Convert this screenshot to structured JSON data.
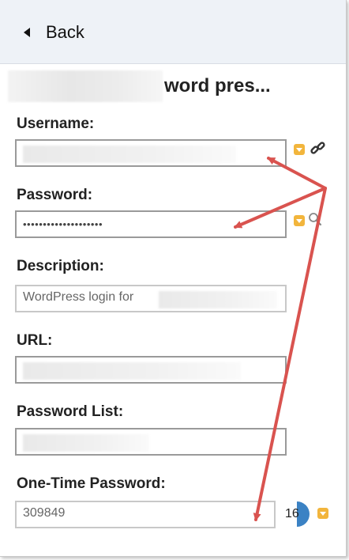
{
  "header": {
    "back_label": "Back"
  },
  "entry": {
    "title_visible": "word pres..."
  },
  "fields": {
    "username": {
      "label": "Username:"
    },
    "password": {
      "label": "Password:",
      "value": "••••••••••••••••••••"
    },
    "description": {
      "label": "Description:",
      "value": "WordPress login for"
    },
    "url": {
      "label": "URL:"
    },
    "password_list": {
      "label": "Password List:"
    },
    "otp": {
      "label": "One-Time Password:",
      "value": "309849",
      "seconds_remaining": "16"
    }
  },
  "colors": {
    "header_bg": "#eef2f7",
    "save_icon": "#f2b53c",
    "annotation_arrow": "#d9534f",
    "timer_blue": "#3b82c4"
  },
  "icons": {
    "back": "triangle-left-icon",
    "save": "save-to-page-icon",
    "link": "link-icon",
    "reveal": "magnifier-icon"
  }
}
